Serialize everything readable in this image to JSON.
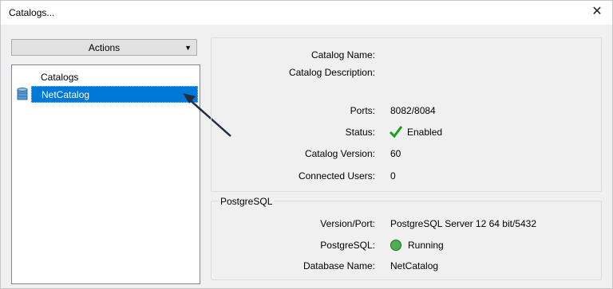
{
  "window": {
    "title": "Catalogs..."
  },
  "icons": {
    "close": "close-icon",
    "caret": "chevron-down-icon",
    "database": "database-icon",
    "status": "checkmark-icon",
    "running": "green-circle-icon"
  },
  "colors": {
    "selection": "#0078d7",
    "check": "#1aa01a",
    "running": "#4caf50"
  },
  "actions": {
    "label": "Actions"
  },
  "tree": {
    "header": "Catalogs",
    "items": [
      {
        "label": "NetCatalog",
        "selected": true
      }
    ]
  },
  "catalog": {
    "name_label": "Catalog Name:",
    "name_value": "",
    "description_label": "Catalog Description:",
    "description_value": "",
    "ports_label": "Ports:",
    "ports_value": "8082/8084",
    "status_label": "Status:",
    "status_value": "Enabled",
    "version_label": "Catalog Version:",
    "version_value": "60",
    "users_label": "Connected Users:",
    "users_value": "0"
  },
  "postgres": {
    "group_title": "PostgreSQL",
    "version_label": "Version/Port:",
    "version_value": "PostgreSQL Server 12 64 bit/5432",
    "state_label": "PostgreSQL:",
    "state_value": "Running",
    "dbname_label": "Database Name:",
    "dbname_value": "NetCatalog"
  }
}
